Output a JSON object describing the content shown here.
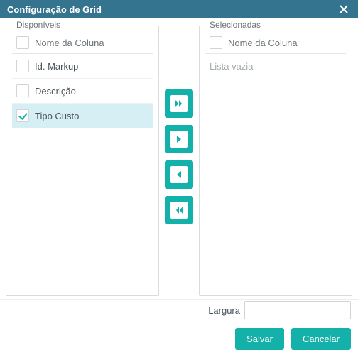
{
  "dialog": {
    "title": "Configuração de Grid"
  },
  "available": {
    "legend": "Disponíveis",
    "header": "Nome da Coluna",
    "items": [
      {
        "label": "Id. Markup",
        "checked": false,
        "selected": false
      },
      {
        "label": "Descrição",
        "checked": false,
        "selected": false
      },
      {
        "label": "Tipo Custo",
        "checked": true,
        "selected": true
      }
    ]
  },
  "selected": {
    "legend": "Selecionadas",
    "header": "Nome da Coluna",
    "empty_text": "Lista vazia"
  },
  "width": {
    "label": "Largura",
    "value": ""
  },
  "buttons": {
    "save": "Salvar",
    "cancel": "Cancelar"
  },
  "colors": {
    "titlebar": "#35748e",
    "accent": "#14b1aa"
  }
}
